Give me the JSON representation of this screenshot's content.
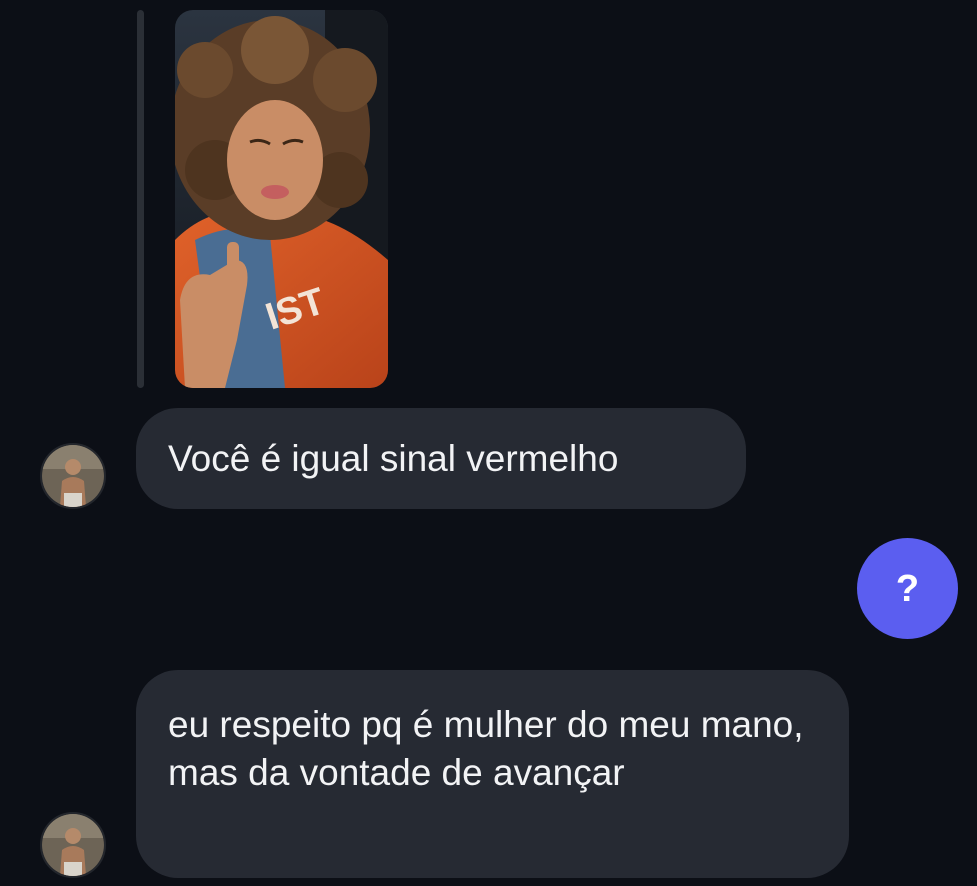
{
  "conversation": {
    "messages": [
      {
        "sender": "other",
        "text": "Você é igual sinal vermelho"
      },
      {
        "sender": "me",
        "text": "?"
      },
      {
        "sender": "other",
        "text": "eu respeito pq é mulher do meu mano, mas da vontade de avançar"
      }
    ]
  },
  "icons": {
    "story_reply": "story-photo",
    "avatar": "contact-avatar-photo"
  },
  "colors": {
    "background": "#0c0f16",
    "incoming_bubble": "#262a33",
    "outgoing_bubble": "#5b5ef0",
    "text": "#f2f3f5"
  }
}
